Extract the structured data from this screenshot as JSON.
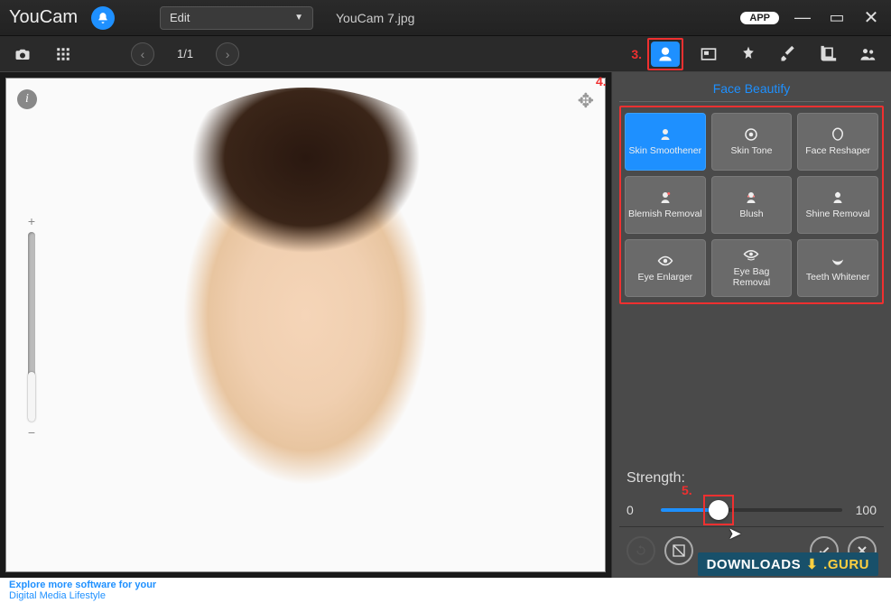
{
  "titlebar": {
    "app_name": "YouCam",
    "mode_label": "Edit",
    "filename": "YouCam 7.jpg",
    "app_badge": "APP"
  },
  "toolbar": {
    "page_counter": "1/1",
    "annotation_3": "3."
  },
  "sidepanel": {
    "annotation_4": "4.",
    "title": "Face Beautify",
    "tools": [
      {
        "id": "skin-smoothener",
        "label": "Skin Smoothener",
        "selected": true
      },
      {
        "id": "skin-tone",
        "label": "Skin Tone",
        "selected": false
      },
      {
        "id": "face-reshaper",
        "label": "Face Reshaper",
        "selected": false
      },
      {
        "id": "blemish-removal",
        "label": "Blemish Removal",
        "selected": false
      },
      {
        "id": "blush",
        "label": "Blush",
        "selected": false
      },
      {
        "id": "shine-removal",
        "label": "Shine Removal",
        "selected": false
      },
      {
        "id": "eye-enlarger",
        "label": "Eye Enlarger",
        "selected": false
      },
      {
        "id": "eye-bag-removal",
        "label": "Eye Bag Removal",
        "selected": false
      },
      {
        "id": "teeth-whitener",
        "label": "Teeth Whitener",
        "selected": false
      }
    ],
    "strength": {
      "label": "Strength:",
      "min": "0",
      "max": "100",
      "value": 32,
      "annotation_5": "5."
    }
  },
  "bottombar": {
    "line1": "Explore more software for your",
    "line2": "Digital Media Lifestyle"
  },
  "watermark": {
    "text1": "DOWNLOADS",
    "text2": ".GURU"
  }
}
